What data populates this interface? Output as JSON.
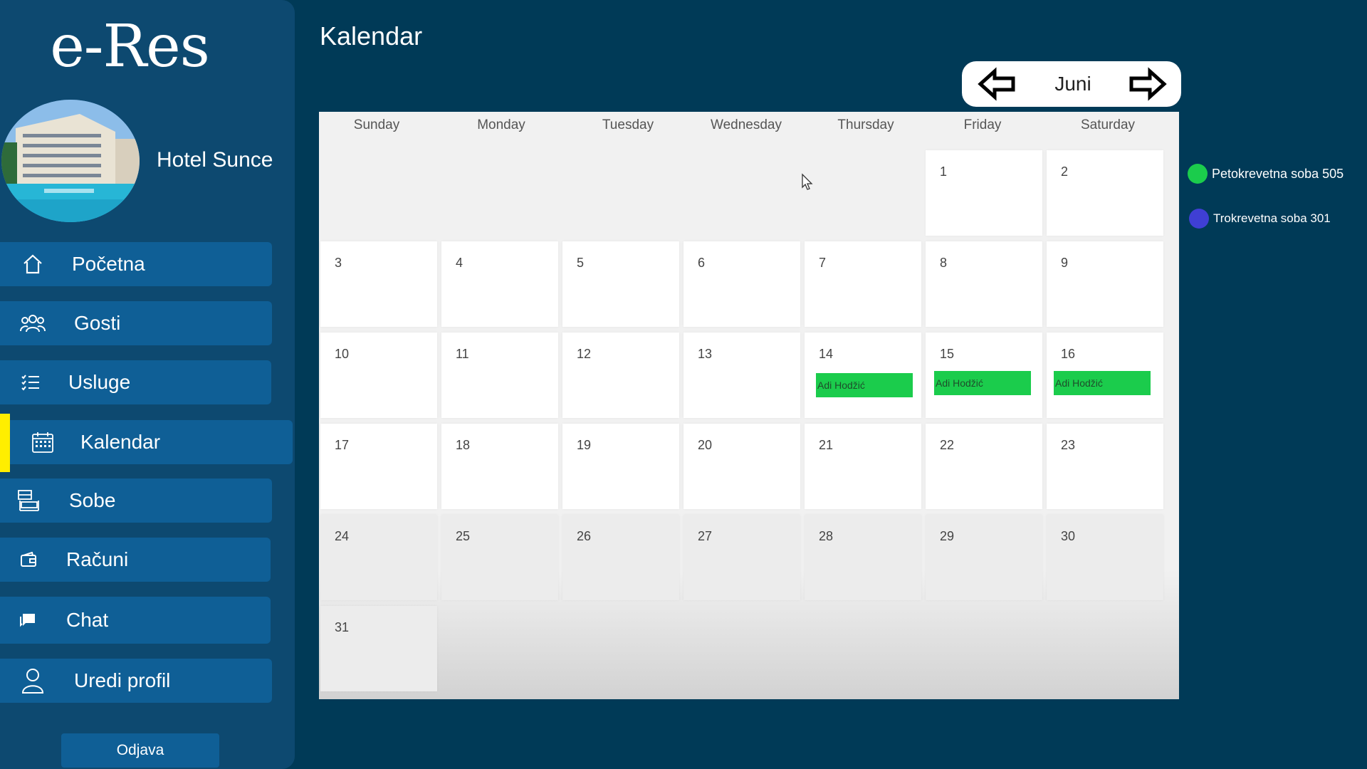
{
  "sidebar": {
    "logo": "e-Res",
    "hotel_name": "Hotel Sunce",
    "items": [
      {
        "label": "Početna",
        "icon": "home-icon"
      },
      {
        "label": "Gosti",
        "icon": "users-icon"
      },
      {
        "label": "Usluge",
        "icon": "checklist-icon"
      },
      {
        "label": "Kalendar",
        "icon": "calendar-icon",
        "active": true
      },
      {
        "label": "Sobe",
        "icon": "room-icon"
      },
      {
        "label": "Računi",
        "icon": "wallet-icon"
      },
      {
        "label": "Chat",
        "icon": "chat-icon"
      },
      {
        "label": "Uredi profil",
        "icon": "user-icon"
      }
    ],
    "logout_label": "Odjava",
    "active_color": "#ffee00"
  },
  "header": {
    "title": "Kalendar",
    "month": "Juni"
  },
  "calendar": {
    "weekdays": [
      "Sunday",
      "Monday",
      "Tuesday",
      "Wednesday",
      "Thursday",
      "Friday",
      "Saturday"
    ],
    "days": [
      "1",
      "2",
      "3",
      "4",
      "5",
      "6",
      "7",
      "8",
      "9",
      "10",
      "11",
      "12",
      "13",
      "14",
      "15",
      "16",
      "17",
      "18",
      "19",
      "20",
      "21",
      "22",
      "23",
      "24",
      "25",
      "26",
      "27",
      "28",
      "29",
      "30",
      "31"
    ],
    "reservations": [
      {
        "day": "14",
        "guest": "Adi Hodžić",
        "color": "#1bcc4c"
      },
      {
        "day": "15",
        "guest": "Adi Hodžić",
        "color": "#1bcc4c"
      },
      {
        "day": "16",
        "guest": "Adi Hodžić",
        "color": "#1bcc4c"
      }
    ]
  },
  "legend": [
    {
      "label": "Petokrevetna soba 505",
      "color": "#1bcc4c"
    },
    {
      "label": "Trokrevetna soba 301",
      "color": "#3f3fd4"
    }
  ]
}
